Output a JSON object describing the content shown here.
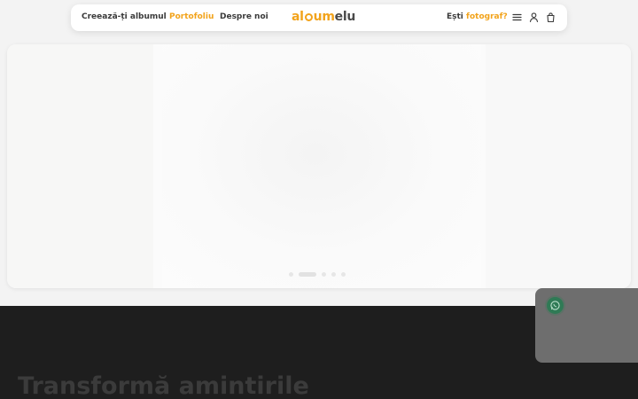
{
  "nav": {
    "links": [
      {
        "label": "Creează-ți albumul",
        "active": false
      },
      {
        "label": "Portofoliu",
        "active": true
      },
      {
        "label": "Despre noi",
        "active": false
      }
    ],
    "logo": {
      "part1": "al",
      "part2": "um",
      "part3": "elu"
    },
    "photographer": {
      "prefix": "Ești",
      "accent": "fotograf?"
    },
    "icons": [
      "menu-icon",
      "user-icon",
      "shopping-bag-icon"
    ]
  },
  "hero": {
    "slides": 5,
    "active_slide": 1
  },
  "section": {
    "headline": "Transformă amintirile"
  },
  "chat": {
    "icon": "whatsapp-icon"
  },
  "colors": {
    "accent": "#f2a31b",
    "dark_section": "#1e1e1e",
    "nav_text": "#3a3a3a",
    "whatsapp": "#2f7a55"
  }
}
